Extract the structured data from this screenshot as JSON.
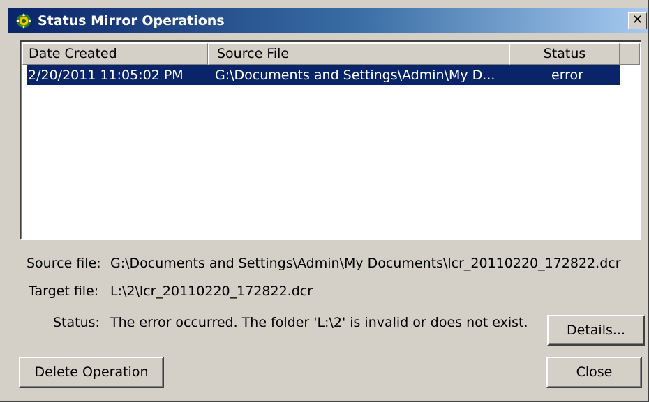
{
  "window": {
    "title": "Status Mirror Operations",
    "close_glyph": "✕"
  },
  "icons": {
    "title_icon": "mirror-app-icon",
    "close_icon": "close-icon"
  },
  "colors": {
    "titlebar_start": "#0a246a",
    "titlebar_end": "#a6caf0",
    "selection": "#0a246a",
    "face": "#d4d0c8"
  },
  "list": {
    "columns": [
      "Date Created",
      "Source File",
      "Status"
    ],
    "rows": [
      {
        "date_created": "2/20/2011 11:05:02 PM",
        "source_file": "G:\\Documents and Settings\\Admin\\My D...",
        "status": "error",
        "selected": true
      }
    ]
  },
  "details": {
    "source_label": "Source file:",
    "source_value": "G:\\Documents and Settings\\Admin\\My Documents\\lcr_20110220_172822.dcr",
    "target_label": "Target file:",
    "target_value": "L:\\2\\lcr_20110220_172822.dcr",
    "status_label": "Status:",
    "status_value": "The error occurred. The folder 'L:\\2' is invalid or does not exist."
  },
  "buttons": {
    "details": "Details...",
    "delete_operation": "Delete Operation",
    "close": "Close"
  }
}
